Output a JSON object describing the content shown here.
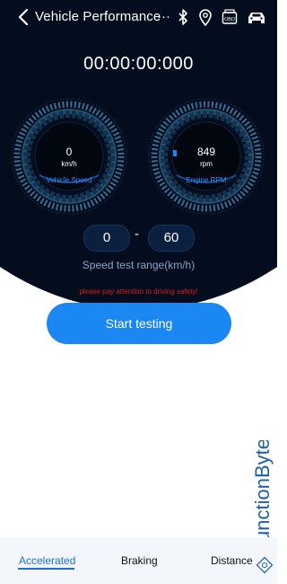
{
  "header": {
    "title": "Vehicle Performance",
    "more": "···",
    "icons": [
      "back-arrow-icon",
      "bluetooth-icon",
      "location-pin-icon",
      "obd-icon",
      "car-icon"
    ],
    "obd_label": "OBD"
  },
  "timer": "00:00:00:000",
  "gauges": [
    {
      "value": "0",
      "unit": "km/h",
      "label": "Vehicle Speed"
    },
    {
      "value": "849",
      "unit": "rpm",
      "label": "Engine RPM"
    }
  ],
  "range": {
    "from": "0",
    "dash": "-",
    "to": "60",
    "label": "Speed test range(km/h)"
  },
  "warning": "please pay attention to driving safety!",
  "start_button": "Start testing",
  "watermark": "JunctionByte",
  "tabs": [
    {
      "label": "Accelerated",
      "active": true
    },
    {
      "label": "Braking",
      "active": false
    },
    {
      "label": "Distance",
      "active": false
    }
  ],
  "colors": {
    "background_dark": "#030d1e",
    "accent_blue": "#1a87f2",
    "warning_red": "#e0191e",
    "active_tab": "#1a6fd8"
  }
}
